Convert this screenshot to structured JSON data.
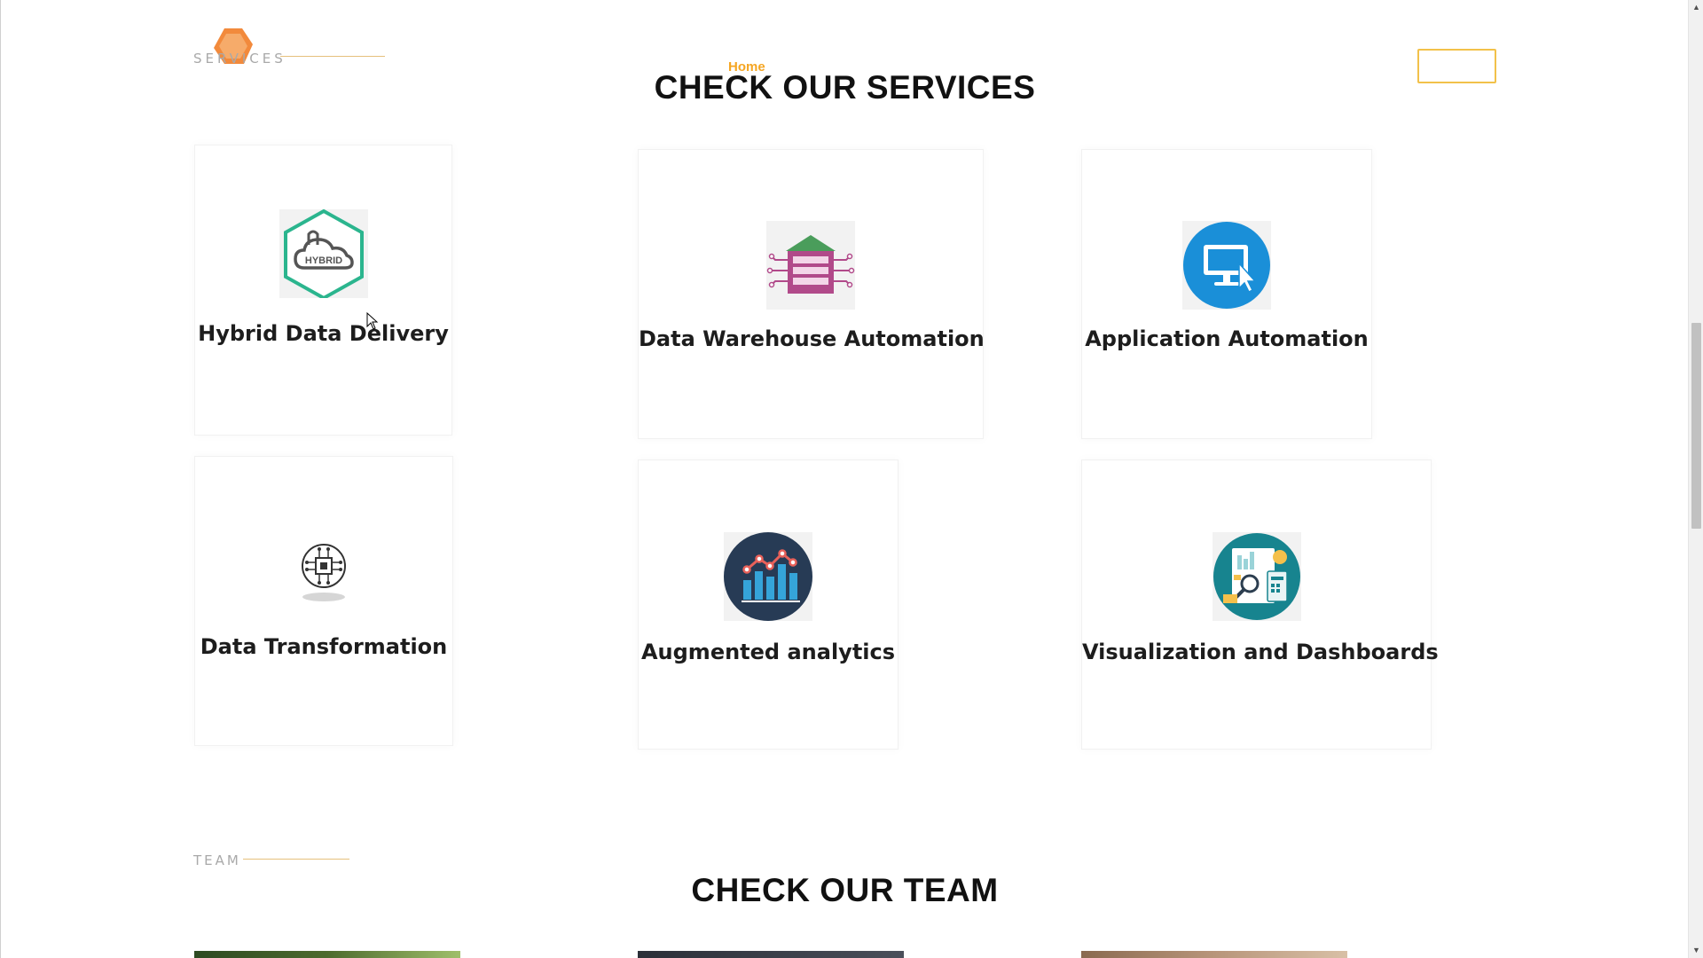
{
  "header": {
    "section_tag": "SERVICES",
    "nav_home": "Home",
    "title": "CHECK OUR SERVICES"
  },
  "services": [
    {
      "title": "Hybrid Data Delivery",
      "icon": "hybrid-cloud-icon"
    },
    {
      "title": "Data Warehouse Automation",
      "icon": "data-warehouse-icon"
    },
    {
      "title": "Application Automation",
      "icon": "monitor-cursor-icon"
    },
    {
      "title": "Data Transformation",
      "icon": "chip-circuit-icon"
    },
    {
      "title": "Augmented analytics",
      "icon": "bar-line-chart-icon"
    },
    {
      "title": "Visualization and Dashboards",
      "icon": "dashboard-analysis-icon"
    }
  ],
  "team": {
    "section_tag": "TEAM",
    "title": "CHECK OUR TEAM"
  },
  "colors": {
    "accent": "#f5a623",
    "button_border": "#f2c14a",
    "hybrid_green": "#2bb58e",
    "app_blue": "#1a8fd8",
    "analytics_navy": "#273b55",
    "viz_teal": "#17848f"
  }
}
